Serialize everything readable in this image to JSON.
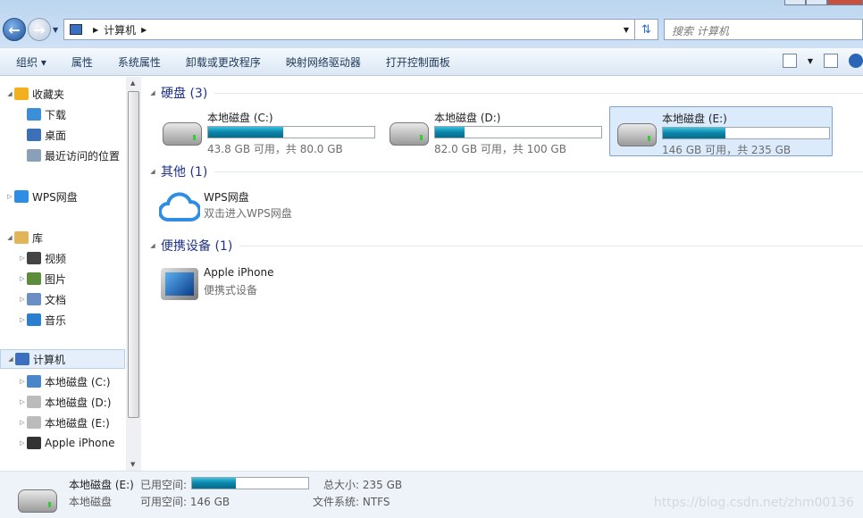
{
  "address": {
    "path": "计算机",
    "search_placeholder": "搜索 计算机"
  },
  "toolbar": {
    "items": [
      "组织 ▾",
      "属性",
      "系统属性",
      "卸载或更改程序",
      "映射网络驱动器",
      "打开控制面板"
    ]
  },
  "sidebar": {
    "items": [
      {
        "label": "收藏夹",
        "level": 0,
        "expanded": true
      },
      {
        "label": "下载",
        "level": 1
      },
      {
        "label": "桌面",
        "level": 1
      },
      {
        "label": "最近访问的位置",
        "level": 1
      },
      {
        "label": "WPS网盘",
        "level": 0
      },
      {
        "label": "库",
        "level": 0,
        "expanded": true
      },
      {
        "label": "视频",
        "level": 1
      },
      {
        "label": "图片",
        "level": 1
      },
      {
        "label": "文档",
        "level": 1
      },
      {
        "label": "音乐",
        "level": 1
      },
      {
        "label": "计算机",
        "level": 0,
        "expanded": true,
        "selected": true
      },
      {
        "label": "本地磁盘 (C:)",
        "level": 1
      },
      {
        "label": "本地磁盘 (D:)",
        "level": 1
      },
      {
        "label": "本地磁盘 (E:)",
        "level": 1
      },
      {
        "label": "Apple iPhone",
        "level": 1
      }
    ]
  },
  "groups": {
    "hdd": "硬盘 (3)",
    "other": "其他 (1)",
    "portable": "便携设备 (1)"
  },
  "drives": [
    {
      "name": "本地磁盘 (C:)",
      "info": "43.8 GB 可用，共 80.0 GB",
      "used_fraction": 0.4525
    },
    {
      "name": "本地磁盘 (D:)",
      "info": "82.0 GB 可用，共 100 GB",
      "used_fraction": 0.18
    },
    {
      "name": "本地磁盘 (E:)",
      "info": "146 GB 可用，共 235 GB",
      "used_fraction": 0.379,
      "selected": true
    }
  ],
  "wps": {
    "name": "WPS网盘",
    "desc": "双击进入WPS网盘"
  },
  "iphone": {
    "name": "Apple iPhone",
    "desc": "便携式设备"
  },
  "status": {
    "name": "本地磁盘 (E:)",
    "type": "本地磁盘",
    "used_label": "已用空间:",
    "free": "可用空间: 146 GB",
    "total": "总大小: 235 GB",
    "fs": "文件系统: NTFS",
    "used_fraction": 0.379
  },
  "watermark": "https://blog.csdn.net/zhm00136",
  "colors": {
    "accent": "#1e3287",
    "bar": "#0c83a8"
  }
}
